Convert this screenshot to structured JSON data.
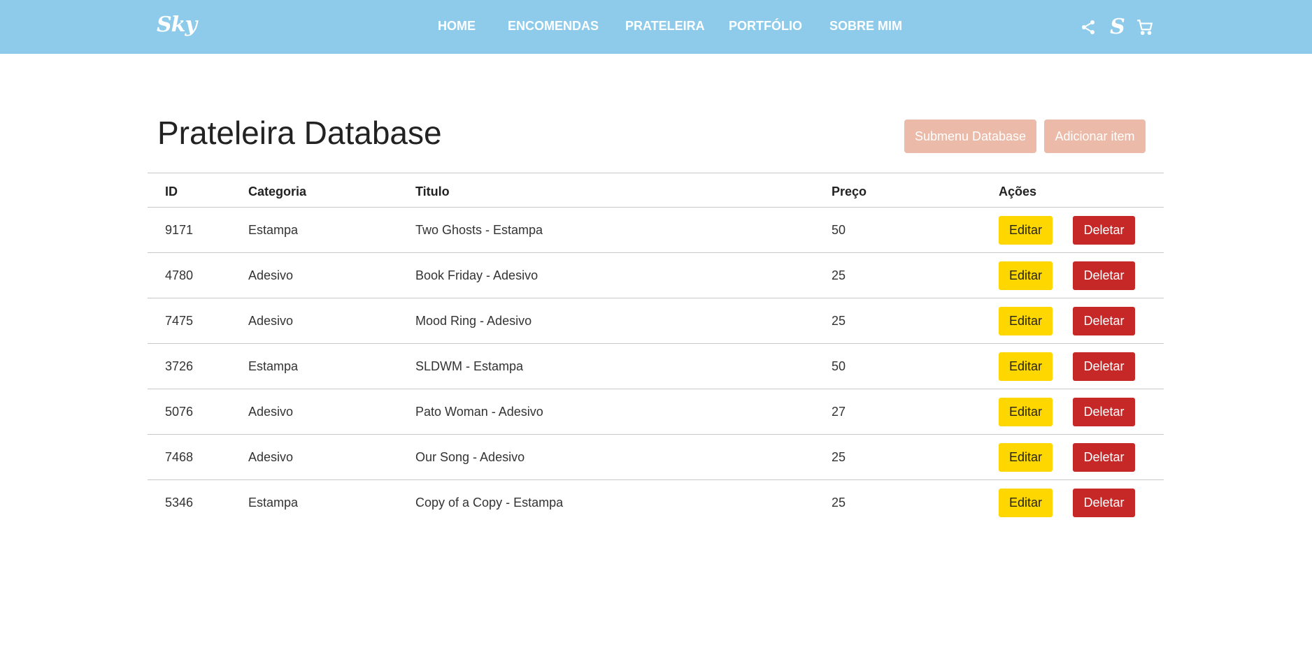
{
  "nav": {
    "logo": "Sky",
    "links": [
      "HOME",
      "ENCOMENDAS",
      "PRATELEIRA",
      "PORTFÓLIO",
      "SOBRE MIM"
    ],
    "icons": [
      "share-icon",
      "s-brand-icon",
      "cart-icon"
    ],
    "s_icon_glyph": "S"
  },
  "page": {
    "title": "Prateleira Database",
    "submenu_button": "Submenu Database",
    "add_button": "Adicionar item"
  },
  "table": {
    "headers": [
      "ID",
      "Categoria",
      "Titulo",
      "Preço",
      "Ações"
    ],
    "edit_label": "Editar",
    "delete_label": "Deletar",
    "rows": [
      {
        "id": "9171",
        "categoria": "Estampa",
        "titulo": "Two Ghosts - Estampa",
        "preco": "50"
      },
      {
        "id": "4780",
        "categoria": "Adesivo",
        "titulo": "Book Friday - Adesivo",
        "preco": "25"
      },
      {
        "id": "7475",
        "categoria": "Adesivo",
        "titulo": "Mood Ring - Adesivo",
        "preco": "25"
      },
      {
        "id": "3726",
        "categoria": "Estampa",
        "titulo": "SLDWM - Estampa",
        "preco": "50"
      },
      {
        "id": "5076",
        "categoria": "Adesivo",
        "titulo": "Pato Woman - Adesivo",
        "preco": "27"
      },
      {
        "id": "7468",
        "categoria": "Adesivo",
        "titulo": "Our Song - Adesivo",
        "preco": "25"
      },
      {
        "id": "5346",
        "categoria": "Estampa",
        "titulo": "Copy of a Copy - Estampa",
        "preco": "25"
      }
    ]
  },
  "colors": {
    "navbar": "#8ecbeb",
    "top_buttons": "#ebbaa8",
    "edit_button": "#ffd700",
    "delete_button": "#c62828"
  }
}
